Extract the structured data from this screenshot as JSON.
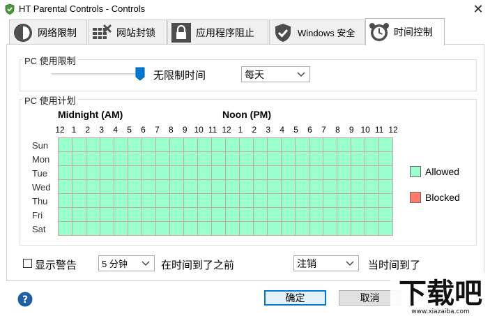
{
  "window": {
    "title": "HT Parental Controls - Controls",
    "icon": "shield-check-icon",
    "close_icon": "close-icon"
  },
  "tabs": [
    {
      "label": "网络限制",
      "icon": "clock-half-icon",
      "active": false
    },
    {
      "label": "网站封锁",
      "icon": "web-block-icon",
      "active": false
    },
    {
      "label": "应用程序阻止",
      "icon": "lock-icon",
      "active": false
    },
    {
      "label": "Windows 安全",
      "icon": "shield-check-icon",
      "active": false
    },
    {
      "label": "时间控制",
      "icon": "alarm-clock-icon",
      "active": true
    }
  ],
  "usage_limit": {
    "title": "PC 使用限制",
    "slider_level": 1.0,
    "limit_text": "无限制时间",
    "period_select": "每天"
  },
  "schedule": {
    "title": "PC 使用计划",
    "am_heading": "Midnight (AM)",
    "pm_heading": "Noon (PM)",
    "hours": [
      "12",
      "1",
      "2",
      "3",
      "4",
      "5",
      "6",
      "7",
      "8",
      "9",
      "10",
      "11",
      "12",
      "1",
      "2",
      "3",
      "4",
      "5",
      "6",
      "7",
      "8",
      "9",
      "10",
      "11",
      "12"
    ],
    "days": [
      "Sun",
      "Mon",
      "Tue",
      "Wed",
      "Thu",
      "Fri",
      "Sat"
    ],
    "allowed_color": "#99ffcc",
    "blocked_color": "#ff7a6b",
    "legend": {
      "allowed": "Allowed",
      "blocked": "Blocked"
    }
  },
  "warning": {
    "checkbox_label": "显示警告",
    "checked": false,
    "minutes_select": "5 分钟",
    "before_text": "在时间到了之前",
    "action_select": "注销",
    "when_text": "当时间到了"
  },
  "buttons": {
    "ok": "确定",
    "cancel": "取消"
  },
  "watermark": {
    "text": "下载吧",
    "url_text": "www.xiazaiba.com"
  }
}
